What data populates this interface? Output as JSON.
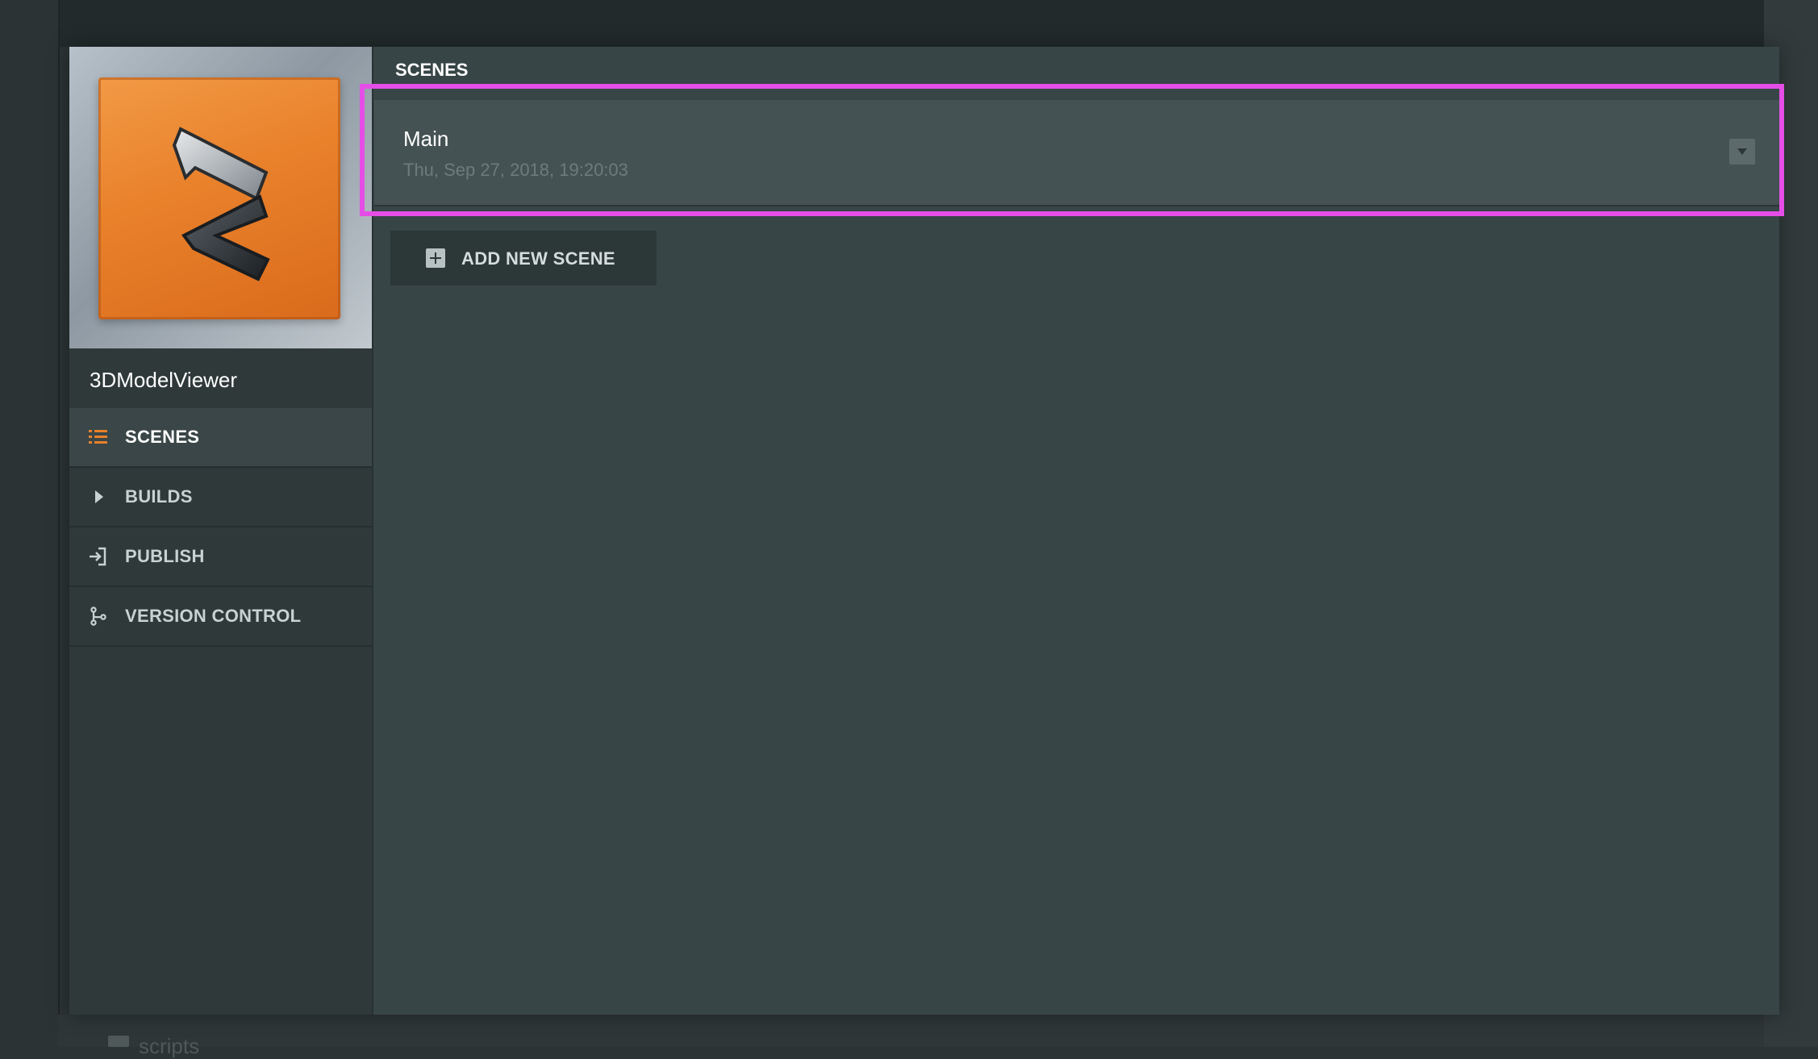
{
  "background": {
    "folder_label": "scripts"
  },
  "project": {
    "name": "3DModelViewer",
    "logo_icon": "project-logo-icon",
    "accent_color": "#e9802a"
  },
  "sidebar": {
    "items": [
      {
        "label": "SCENES",
        "icon": "list-icon",
        "active": true
      },
      {
        "label": "BUILDS",
        "icon": "play-icon",
        "active": false
      },
      {
        "label": "PUBLISH",
        "icon": "publish-icon",
        "active": false
      },
      {
        "label": "VERSION CONTROL",
        "icon": "branch-icon",
        "active": false
      }
    ]
  },
  "main": {
    "section_title": "SCENES",
    "scenes": [
      {
        "name": "Main",
        "modified": "Thu, Sep 27, 2018, 19:20:03",
        "icon": "chevron-down-icon"
      }
    ],
    "add_button_label": "ADD NEW SCENE",
    "highlight_color": "#e44ee6"
  }
}
